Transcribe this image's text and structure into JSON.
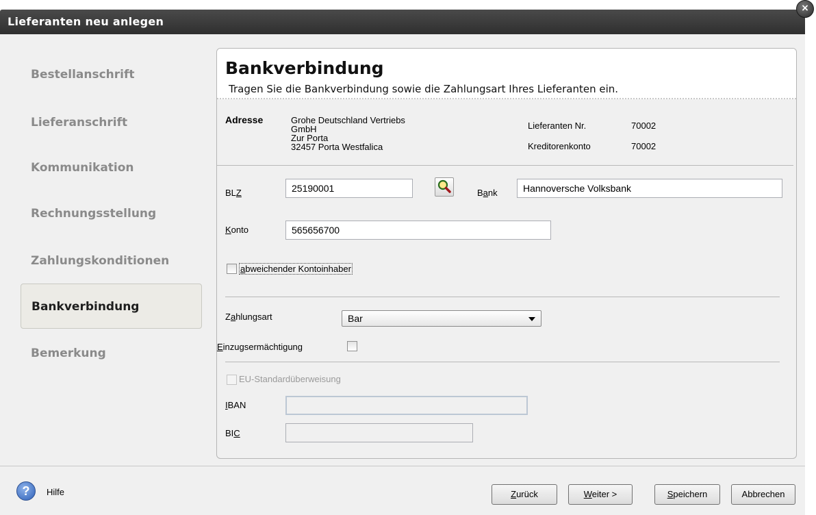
{
  "window": {
    "title": "Lieferanten neu anlegen",
    "close_glyph": "×"
  },
  "sidebar": {
    "items": [
      {
        "label": "Bestellanschrift"
      },
      {
        "label": "Lieferanschrift"
      },
      {
        "label": "Kommunikation"
      },
      {
        "label": "Rechnungsstellung"
      },
      {
        "label": "Zahlungskonditionen"
      },
      {
        "label": "Bankverbindung",
        "active": true
      },
      {
        "label": "Bemerkung"
      }
    ]
  },
  "main": {
    "title": "Bankverbindung",
    "subtitle": "Tragen Sie die Bankverbindung sowie die Zahlungsart Ihres Lieferanten ein.",
    "address": {
      "label": "Adresse",
      "lines": [
        "Grohe Deutschland Vertriebs",
        "GmbH",
        "Zur Porta",
        "32457 Porta Westfalica"
      ]
    },
    "supplier_no": {
      "label": "Lieferanten Nr.",
      "value": "70002"
    },
    "creditor_account": {
      "label": "Kreditorenkonto",
      "value": "70002"
    },
    "blz": {
      "label_pre": "BL",
      "label_u": "Z",
      "label_post": "",
      "value": "25190001"
    },
    "bank": {
      "label_pre": "B",
      "label_u": "a",
      "label_post": "nk",
      "value": "Hannoversche Volksbank"
    },
    "konto": {
      "label_pre": "",
      "label_u": "K",
      "label_post": "onto",
      "value": "565656700"
    },
    "alt_holder": {
      "label_pre": "",
      "label_u": "a",
      "label_post": "bweichender Kontoinhaber",
      "checked": false
    },
    "payment_type": {
      "label_pre": "Z",
      "label_u": "a",
      "label_post": "hlungsart",
      "value": "Bar"
    },
    "direct_debit": {
      "label_pre": "",
      "label_u": "E",
      "label_post": "inzugsermächtigung",
      "checked": false
    },
    "eu_transfer": {
      "label": "EU-Standardüberweisung",
      "checked": false,
      "enabled": false
    },
    "iban": {
      "label_pre": "",
      "label_u": "I",
      "label_post": "BAN",
      "value": ""
    },
    "bic": {
      "label_pre": "BI",
      "label_u": "C",
      "label_post": "",
      "value": ""
    }
  },
  "footer": {
    "help_glyph": "?",
    "help_label": "Hilfe",
    "back": {
      "label_pre": "",
      "label_u": "Z",
      "label_post": "urück"
    },
    "next": {
      "label_pre": "",
      "label_u": "W",
      "label_post": "eiter >"
    },
    "save": {
      "label_pre": "",
      "label_u": "S",
      "label_post": "peichern"
    },
    "cancel": {
      "label": "Abbrechen"
    }
  },
  "colors": {
    "titlebar": "#3a3a3a",
    "accent_help": "#2c5fb7",
    "panel_bg": "#f0f0f0"
  }
}
